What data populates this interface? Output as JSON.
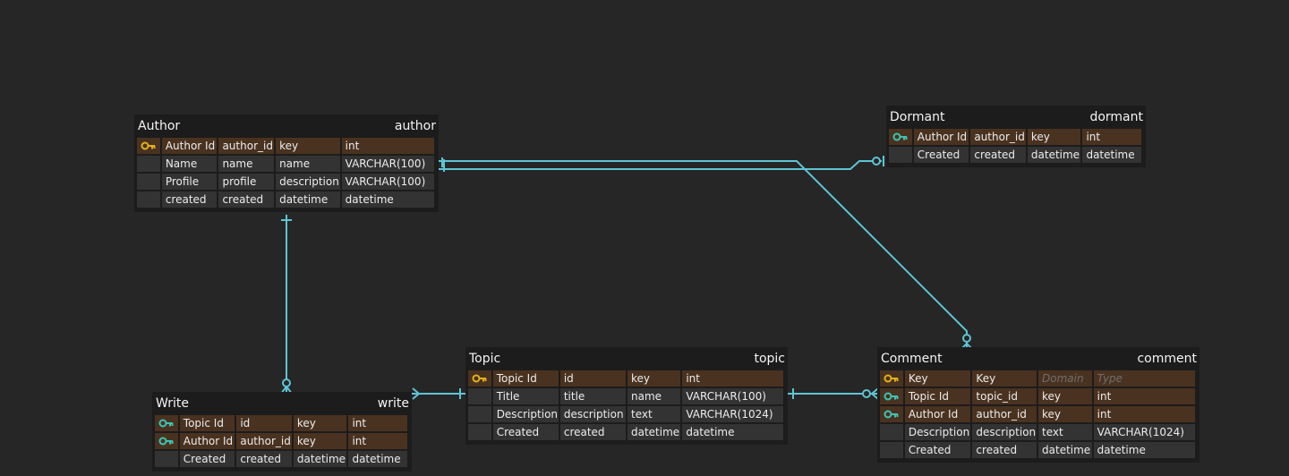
{
  "tables": {
    "author": {
      "logical": "Author",
      "physical": "author",
      "rows": [
        {
          "kind": "pk",
          "logical": "Author Id",
          "physical": "author_id",
          "domain": "key",
          "type": "int"
        },
        {
          "kind": "plain",
          "logical": "Name",
          "physical": "name",
          "domain": "name",
          "type": "VARCHAR(100)"
        },
        {
          "kind": "plain",
          "logical": "Profile",
          "physical": "profile",
          "domain": "description",
          "type": "VARCHAR(100)"
        },
        {
          "kind": "plain",
          "logical": "created",
          "physical": "created",
          "domain": "datetime",
          "type": "datetime"
        }
      ]
    },
    "dormant": {
      "logical": "Dormant",
      "physical": "dormant",
      "rows": [
        {
          "kind": "fk",
          "logical": "Author Id",
          "physical": "author_id",
          "domain": "key",
          "type": "int"
        },
        {
          "kind": "plain",
          "logical": "Created",
          "physical": "created",
          "domain": "datetime",
          "type": "datetime"
        }
      ]
    },
    "write": {
      "logical": "Write",
      "physical": "write",
      "rows": [
        {
          "kind": "fk",
          "logical": "Topic Id",
          "physical": "id",
          "domain": "key",
          "type": "int"
        },
        {
          "kind": "fk",
          "logical": "Author Id",
          "physical": "author_id",
          "domain": "key",
          "type": "int"
        },
        {
          "kind": "plain",
          "logical": "Created",
          "physical": "created",
          "domain": "datetime",
          "type": "datetime"
        }
      ]
    },
    "topic": {
      "logical": "Topic",
      "physical": "topic",
      "rows": [
        {
          "kind": "pk",
          "logical": "Topic Id",
          "physical": "id",
          "domain": "key",
          "type": "int"
        },
        {
          "kind": "plain",
          "logical": "Title",
          "physical": "title",
          "domain": "name",
          "type": "VARCHAR(100)"
        },
        {
          "kind": "plain",
          "logical": "Description",
          "physical": "description",
          "domain": "text",
          "type": "VARCHAR(1024)"
        },
        {
          "kind": "plain",
          "logical": "Created",
          "physical": "created",
          "domain": "datetime",
          "type": "datetime"
        }
      ]
    },
    "comment": {
      "logical": "Comment",
      "physical": "comment",
      "rows": [
        {
          "kind": "pk",
          "logical": "Key",
          "physical": "Key",
          "domain": "Domain",
          "type": "Type"
        },
        {
          "kind": "fk",
          "logical": "Topic Id",
          "physical": "topic_id",
          "domain": "key",
          "type": "int"
        },
        {
          "kind": "fk",
          "logical": "Author Id",
          "physical": "author_id",
          "domain": "key",
          "type": "int"
        },
        {
          "kind": "plain",
          "logical": "Description",
          "physical": "description",
          "domain": "text",
          "type": "VARCHAR(1024)"
        },
        {
          "kind": "plain",
          "logical": "Created",
          "physical": "created",
          "domain": "datetime",
          "type": "datetime"
        }
      ]
    }
  },
  "colors": {
    "background": "#262626",
    "connector": "#5ec4d4",
    "pk_key": "#e2b21a",
    "fk_key": "#3cc4b4",
    "key_row": "#4a3220",
    "plain_row": "#333333"
  }
}
